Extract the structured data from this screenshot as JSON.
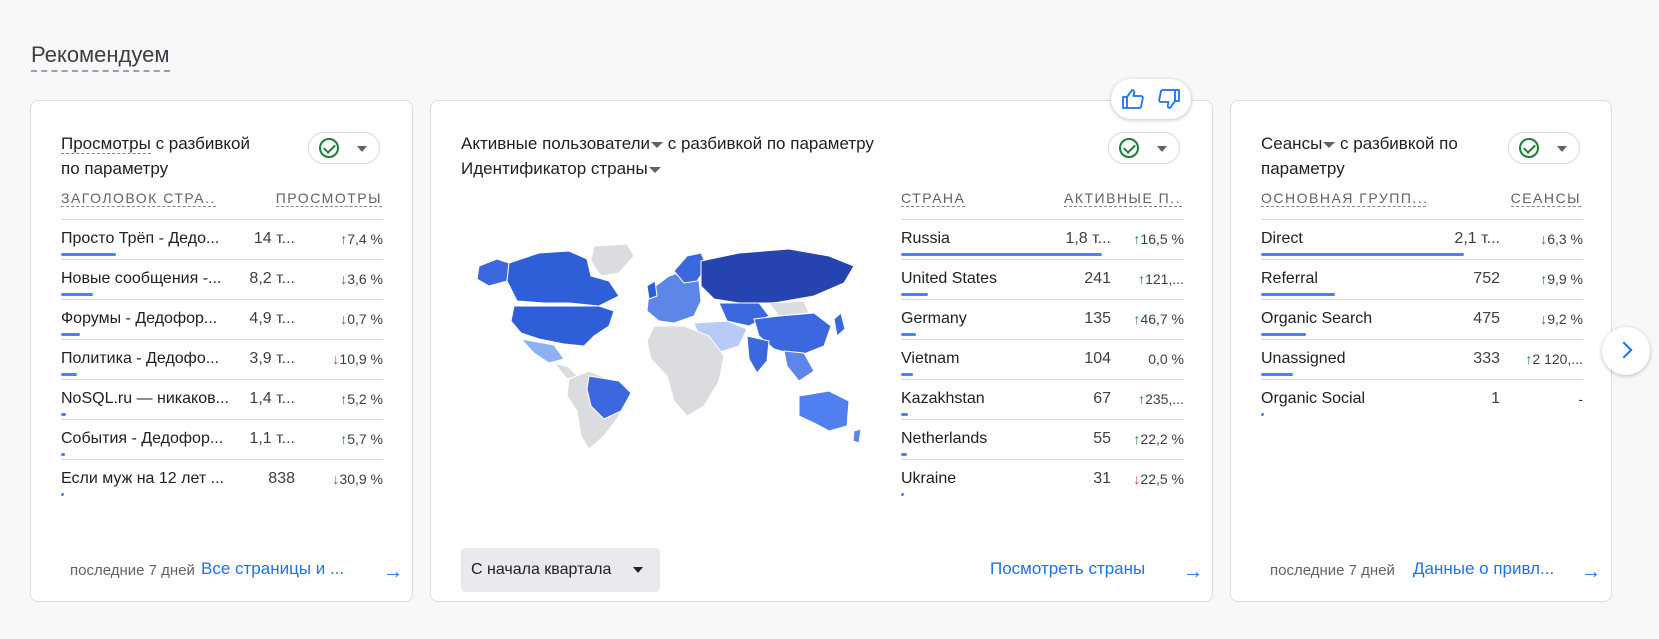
{
  "section_title": "Рекомендуем",
  "colors": {
    "accent": "#1a73e8",
    "bar": "#4285f4",
    "up": "#188038",
    "down": "#d93025"
  },
  "card1": {
    "title_part1": "Просмотры",
    "title_part2": " с разбивкой",
    "title_line2": "по параметру",
    "col_name": "ЗАГОЛОВОК СТРА...",
    "col_value": "ПРОСМОТРЫ",
    "rows": [
      {
        "name": "Просто Трёп - Дедо...",
        "value": "14 т...",
        "dir": "up",
        "arrow": "↑",
        "change": "7,4 %",
        "share": 0.17
      },
      {
        "name": "Новые сообщения -...",
        "value": "8,2 т...",
        "dir": "down",
        "arrow": "↓",
        "change": "3,6 %",
        "share": 0.1
      },
      {
        "name": "Форумы - Дедофор...",
        "value": "4,9 т...",
        "dir": "down",
        "arrow": "↓",
        "change": "0,7 %",
        "share": 0.06
      },
      {
        "name": "Политика - Дедофо...",
        "value": "3,9 т...",
        "dir": "down",
        "arrow": "↓",
        "change": "10,9 %",
        "share": 0.05
      },
      {
        "name": "NoSQL.ru — никаков...",
        "value": "1,4 т...",
        "dir": "up",
        "arrow": "↑",
        "change": "5,2 %",
        "share": 0.015
      },
      {
        "name": "События - Дедофор...",
        "value": "1,1 т...",
        "dir": "up",
        "arrow": "↑",
        "change": "5,7 %",
        "share": 0.013
      },
      {
        "name": "Если муж на 12 лет ...",
        "value": "838",
        "dir": "down",
        "arrow": "↓",
        "change": "30,9 %",
        "share": 0.01
      }
    ],
    "period": "последние 7 дней",
    "link": "Все страницы и ..."
  },
  "card2": {
    "title_metric": "Активные пользователи",
    "title_rest": " с разбивкой по параметру",
    "title_dim": "Идентификатор страны",
    "col_name": "СТРАНА",
    "col_value": "АКТИВНЫЕ П...",
    "rows": [
      {
        "name": "Russia",
        "value": "1,8 т...",
        "dir": "up",
        "arrow": "↑",
        "change": "16,5 %",
        "share": 0.71
      },
      {
        "name": "United States",
        "value": "241",
        "dir": "up",
        "arrow": "↑",
        "change": "121,...",
        "share": 0.095
      },
      {
        "name": "Germany",
        "value": "135",
        "dir": "up",
        "arrow": "↑",
        "change": "46,7 %",
        "share": 0.053
      },
      {
        "name": "Vietnam",
        "value": "104",
        "dir": "none",
        "arrow": "",
        "change": "0,0 %",
        "share": 0.041
      },
      {
        "name": "Kazakhstan",
        "value": "67",
        "dir": "up",
        "arrow": "↑",
        "change": "235,...",
        "share": 0.026
      },
      {
        "name": "Netherlands",
        "value": "55",
        "dir": "up",
        "arrow": "↑",
        "change": "22,2 %",
        "share": 0.022
      },
      {
        "name": "Ukraine",
        "value": "31",
        "dir": "down",
        "arrow": "↓",
        "change": "22,5 %",
        "share": 0.012
      }
    ],
    "period_button": "С начала квартала",
    "link": "Посмотреть страны"
  },
  "card3": {
    "title_metric": "Сеансы",
    "title_rest": " с разбивкой по",
    "title_line2": "параметру",
    "col_name": "ОСНОВНАЯ ГРУПП...",
    "col_value": "СЕАНСЫ",
    "rows": [
      {
        "name": "Direct",
        "value": "2,1 т...",
        "dir": "down",
        "arrow": "↓",
        "change": "6,3 %",
        "share": 0.63
      },
      {
        "name": "Referral",
        "value": "752",
        "dir": "up",
        "arrow": "↑",
        "change": "9,9 %",
        "share": 0.23
      },
      {
        "name": "Organic Search",
        "value": "475",
        "dir": "down",
        "arrow": "↓",
        "change": "9,2 %",
        "share": 0.14
      },
      {
        "name": "Unassigned",
        "value": "333",
        "dir": "up",
        "arrow": "↑",
        "change": "2 120,...",
        "share": 0.1
      },
      {
        "name": "Organic Social",
        "value": "1",
        "dir": "none",
        "arrow": "",
        "change": "-",
        "share": 0.003
      }
    ],
    "period": "последние 7 дней",
    "link": "Данные о привл..."
  }
}
